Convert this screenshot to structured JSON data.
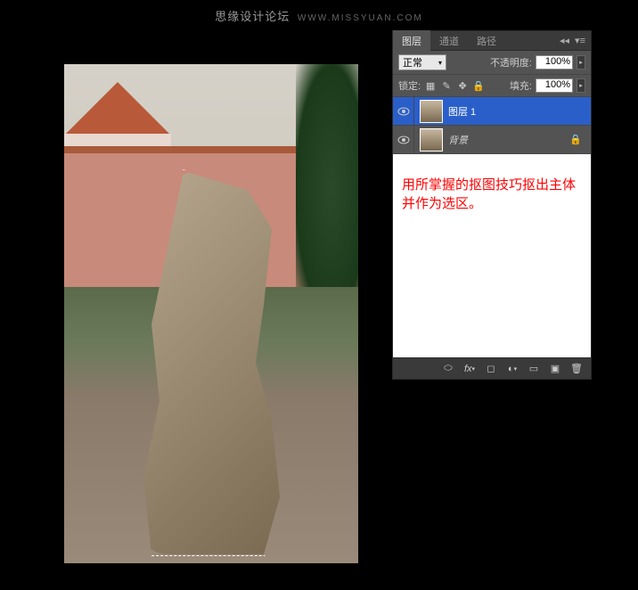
{
  "watermark": {
    "main": "思缘设计论坛",
    "sub": "WWW.MISSYUAN.COM"
  },
  "panel": {
    "tabs": [
      "图层",
      "通道",
      "路径"
    ],
    "active_tab": 0,
    "blend_mode": "正常",
    "opacity_label": "不透明度:",
    "opacity_value": "100%",
    "lock_label": "锁定:",
    "fill_label": "填充:",
    "fill_value": "100%",
    "layers": [
      {
        "name": "图层 1",
        "visible": true,
        "selected": true,
        "locked": false
      },
      {
        "name": "背景",
        "visible": true,
        "selected": false,
        "locked": true
      }
    ],
    "instruction": "用所掌握的抠图技巧抠出主体并作为选区。",
    "footer_icons": [
      "link",
      "fx",
      "mask",
      "adjust",
      "group",
      "new",
      "trash"
    ]
  }
}
